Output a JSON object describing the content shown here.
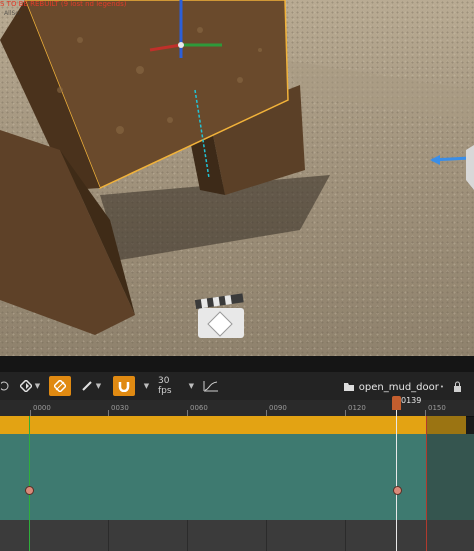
{
  "viewport": {
    "warning_text": "S TO BE REBUILT (9 lost nd legends)",
    "subtitle_text": "AllScr"
  },
  "toolbar": {
    "fps_label": "30 fps",
    "sequence_name": "open_mud_door"
  },
  "timeline": {
    "ticks": [
      "0000",
      "0030",
      "0060",
      "0090",
      "0120",
      "0150"
    ],
    "playhead_frame": "0139"
  },
  "colors": {
    "section_bar": "#e3a313",
    "track": "#3e7a70",
    "playhead": "#c45e2e",
    "start_marker": "#2fae3a",
    "end_marker": "#b03a2e"
  }
}
